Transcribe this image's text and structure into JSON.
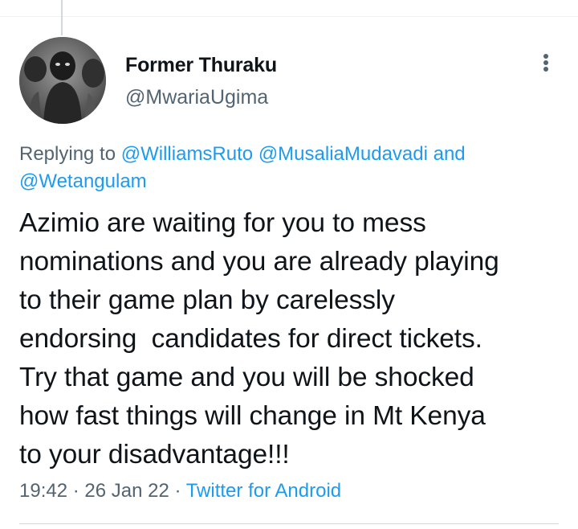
{
  "author": {
    "display_name": "Former Thuraku",
    "handle": "@MwariaUgima"
  },
  "more_icon": "more-vertical-icon",
  "reply_context": {
    "prefix": "Replying to ",
    "mentions": [
      "@WilliamsRuto",
      "@MusaliaMudavadi",
      "@Wetangulam"
    ],
    "sep_space": " ",
    "conjunction": " and"
  },
  "tweet": {
    "text": "Azimio are waiting for you to mess\nnominations and you are already playing\nto their game plan by carelessly\nendorsing  candidates for direct tickets.\nTry that game and you will be shocked\nhow fast things will change in Mt Kenya\nto your disadvantage!!!"
  },
  "meta": {
    "time": "19:42",
    "separator": " · ",
    "date": "26 Jan 22",
    "source": "Twitter for Android"
  },
  "colors": {
    "link": "#1d9bf0",
    "secondary_text": "#536471",
    "primary_text": "#0f1419"
  }
}
